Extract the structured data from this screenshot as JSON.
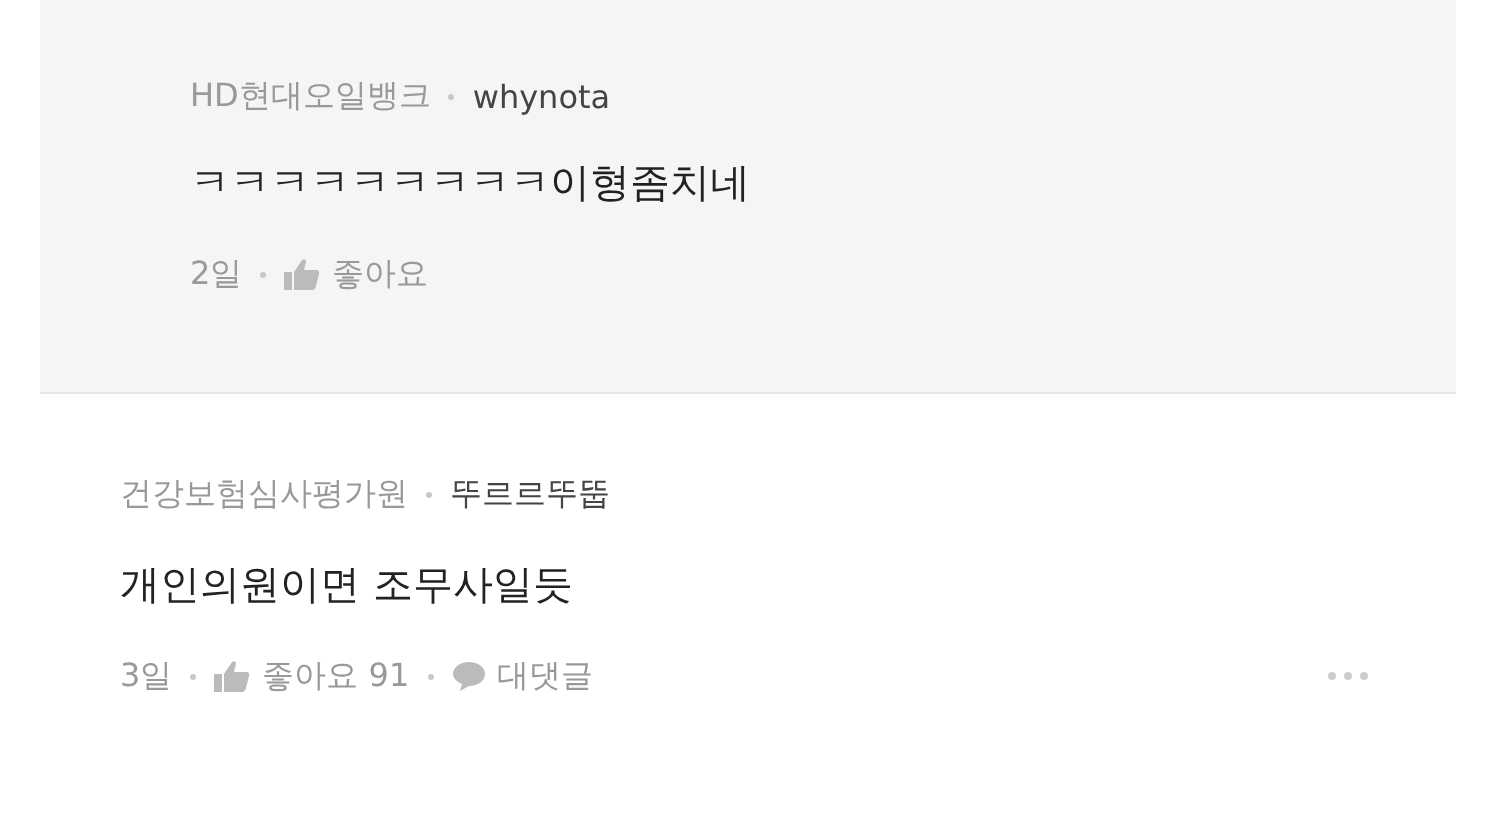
{
  "comments": [
    {
      "kind": "reply",
      "company": "HD현대오일뱅크",
      "author": "whynota",
      "text": "ㅋㅋㅋㅋㅋㅋㅋㅋㅋ이형좀치네",
      "age": "2일",
      "like_label": "좋아요"
    },
    {
      "kind": "comment",
      "company": "건강보험심사평가원",
      "author": "뚜르르뚜뚭",
      "text": "개인의원이면 조무사일듯",
      "age": "3일",
      "like_label": "좋아요 91",
      "reply_label": "대댓글"
    }
  ]
}
